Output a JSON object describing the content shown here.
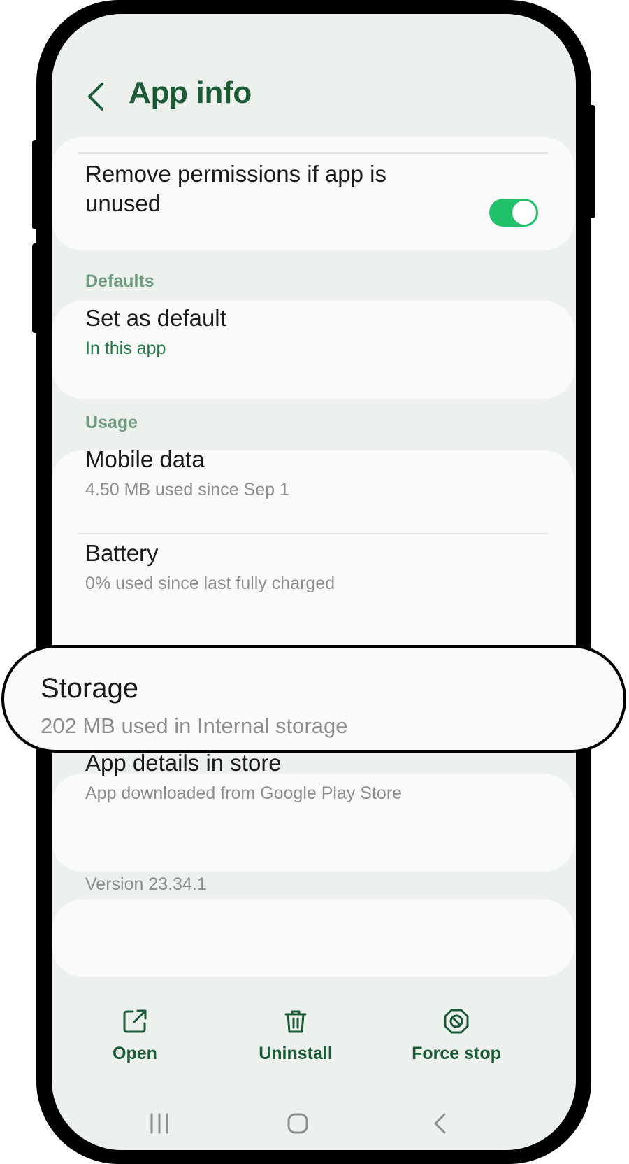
{
  "header": {
    "title": "App info"
  },
  "permissions": {
    "toggle_label": "Remove permissions if app is unused",
    "toggle_on": true
  },
  "defaults": {
    "section_title": "Defaults",
    "set_default": {
      "title": "Set as default",
      "subtitle": "In this app"
    }
  },
  "usage": {
    "section_title": "Usage",
    "mobile_data": {
      "title": "Mobile data",
      "subtitle": "4.50 MB used since Sep 1"
    },
    "battery": {
      "title": "Battery",
      "subtitle": "0% used since last fully charged"
    },
    "storage": {
      "title": "Storage",
      "subtitle": "202 MB used in Internal storage"
    }
  },
  "store": {
    "title": "App details in store",
    "subtitle": "App downloaded from Google Play Store"
  },
  "version": {
    "label": "Version 23.34.1"
  },
  "actions": [
    {
      "label": "Open",
      "icon": "open-external-icon"
    },
    {
      "label": "Uninstall",
      "icon": "trash-icon"
    },
    {
      "label": "Force stop",
      "icon": "stop-icon"
    }
  ],
  "nav": {
    "icons": [
      "recent-apps-icon",
      "home-icon",
      "back-icon"
    ]
  },
  "colors": {
    "accent": "#1b5a35",
    "toggle": "#21c06a",
    "background": "#edf1ee",
    "card": "#fafafa"
  }
}
